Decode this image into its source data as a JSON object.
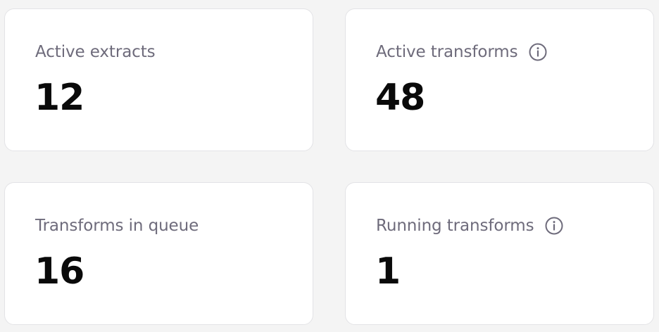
{
  "metrics": [
    {
      "label": "Active extracts",
      "value": "12",
      "info_icon": false
    },
    {
      "label": "Active transforms",
      "value": "48",
      "info_icon": true,
      "icon": "info-circle-icon"
    },
    {
      "label": "Transforms in queue",
      "value": "16",
      "info_icon": false
    },
    {
      "label": "Running transforms",
      "value": "1",
      "info_icon": true,
      "icon": "info-circle-icon"
    }
  ],
  "colors": {
    "page_background": "#f4f4f4",
    "card_background": "#ffffff",
    "card_border": "#e3e3e6",
    "label_text": "#6e6b7b",
    "value_text": "#0a0a0a",
    "icon_stroke": "#6e6b7b"
  }
}
